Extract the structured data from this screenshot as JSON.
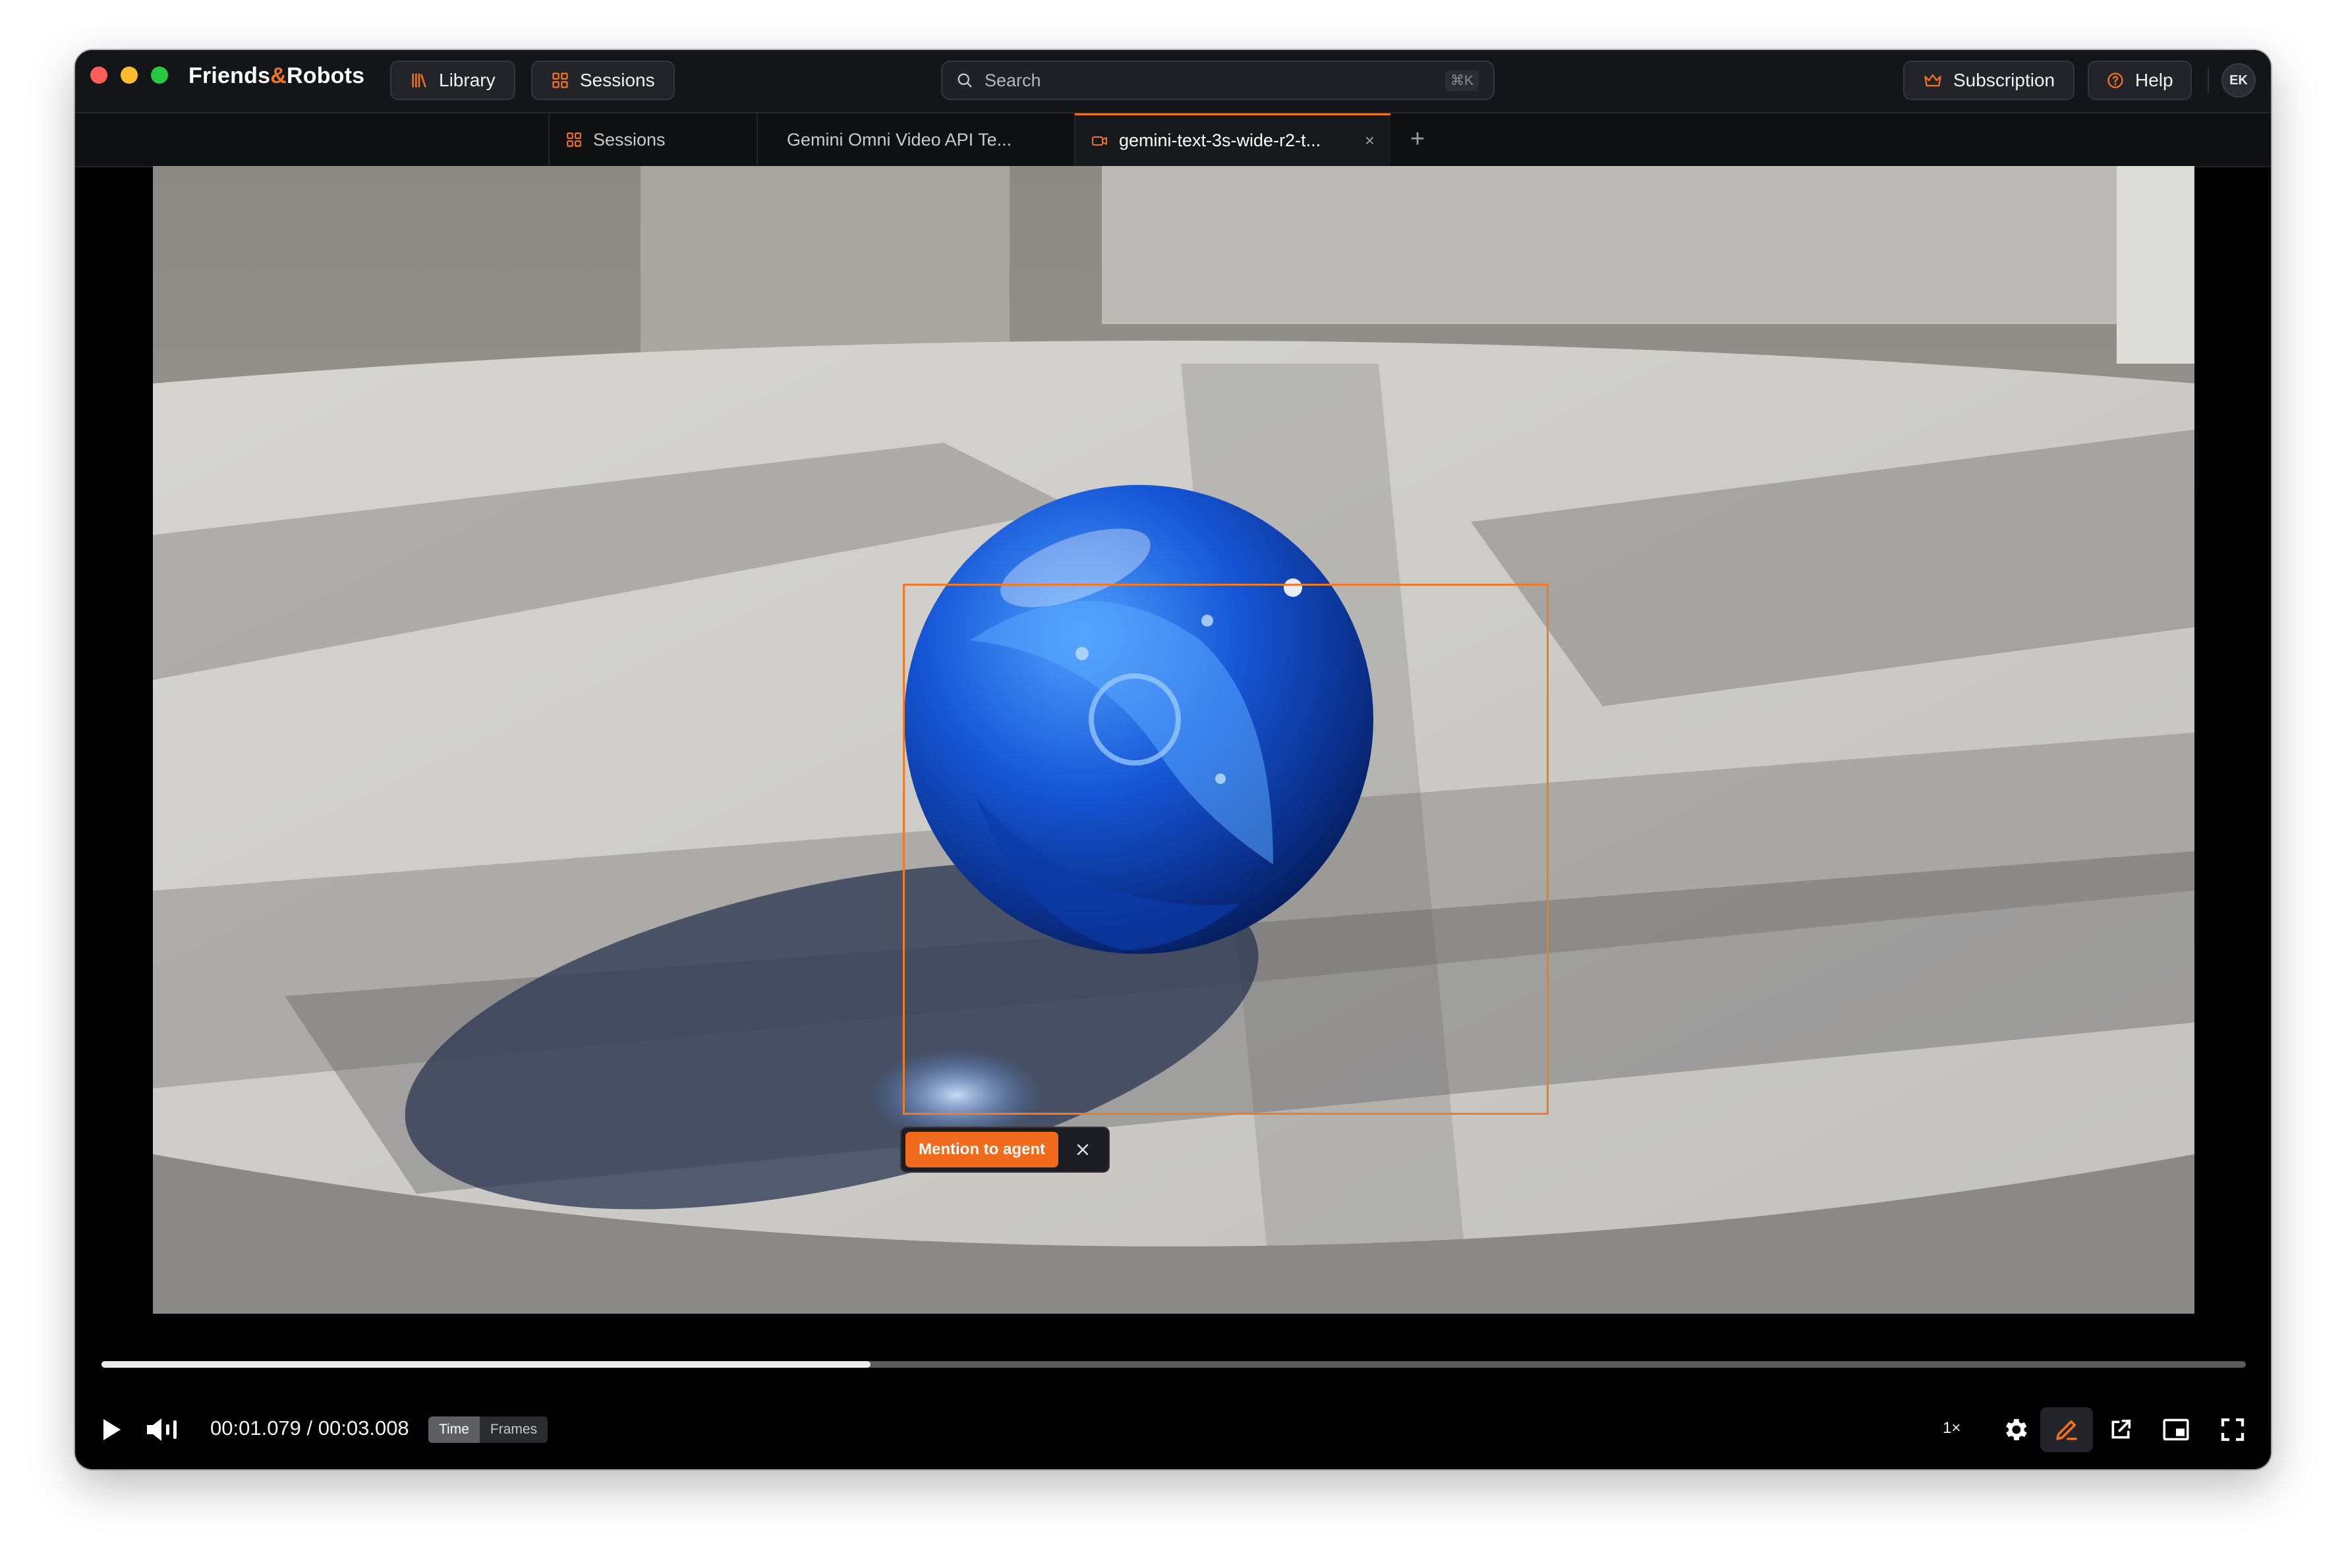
{
  "app": {
    "brand_left": "Friends",
    "brand_amp": "&",
    "brand_right": "Robots"
  },
  "header": {
    "library_label": "Library",
    "sessions_label": "Sessions",
    "search_placeholder": "Search",
    "search_shortcut": "⌘K",
    "subscription_label": "Subscription",
    "help_label": "Help",
    "avatar_initials": "EK"
  },
  "tabs": [
    {
      "label": "Sessions",
      "icon": "grid-icon",
      "active": false
    },
    {
      "label": "Gemini Omni Video API Te...",
      "icon": "dot-icon",
      "active": false
    },
    {
      "label": "gemini-text-3s-wide-r2-t...",
      "icon": "video-icon",
      "active": true
    }
  ],
  "new_tab_label": "+",
  "overlay": {
    "mention_label": "Mention to agent"
  },
  "player": {
    "current_time": "00:01.079",
    "separator": " / ",
    "duration": "00:03.008",
    "mode_time_label": "Time",
    "mode_frames_label": "Frames",
    "active_mode": "Time",
    "playback_rate": "1×",
    "progress_fraction": 0.3587
  },
  "colors": {
    "accent": "#f0741e",
    "window_bg": "#000000",
    "titlebar_bg": "#141518"
  }
}
